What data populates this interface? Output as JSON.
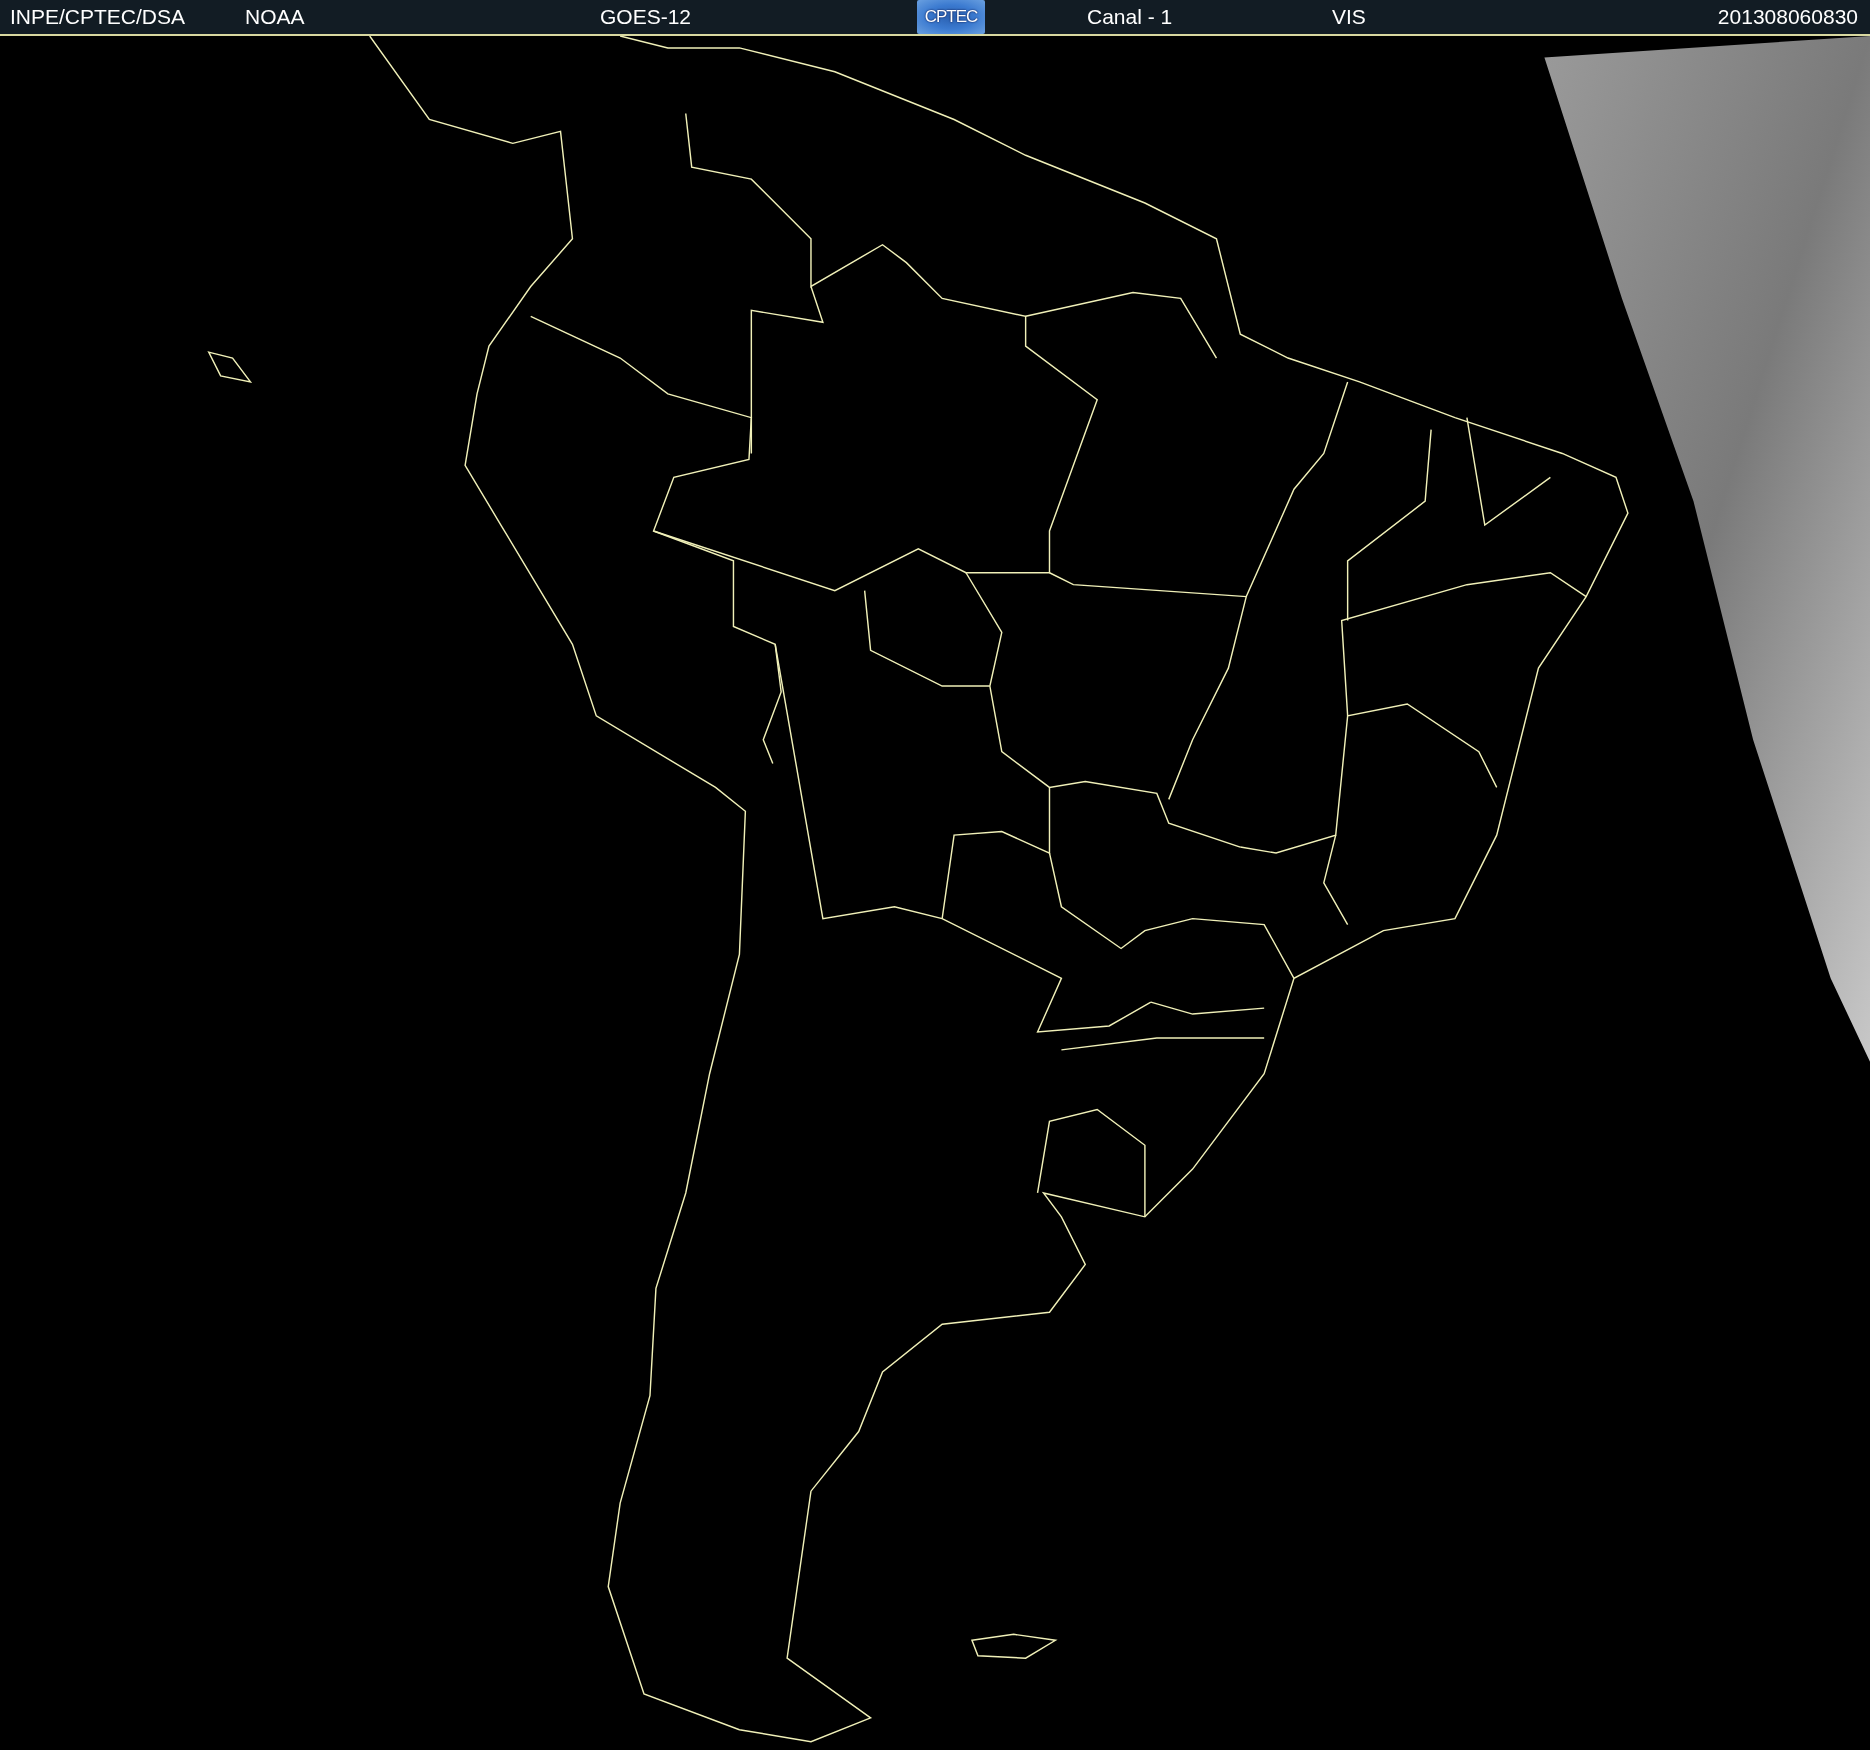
{
  "header": {
    "items": [
      {
        "kind": "text",
        "label": "INPE/CPTEC/DSA"
      },
      {
        "kind": "text",
        "label": "NOAA"
      },
      {
        "kind": "text",
        "label": "GOES-12"
      },
      {
        "kind": "logo",
        "label": "CPTEC"
      },
      {
        "kind": "text",
        "label": "Canal - 1"
      },
      {
        "kind": "text",
        "label": "VIS"
      },
      {
        "kind": "text",
        "label": "201308060830"
      }
    ]
  }
}
